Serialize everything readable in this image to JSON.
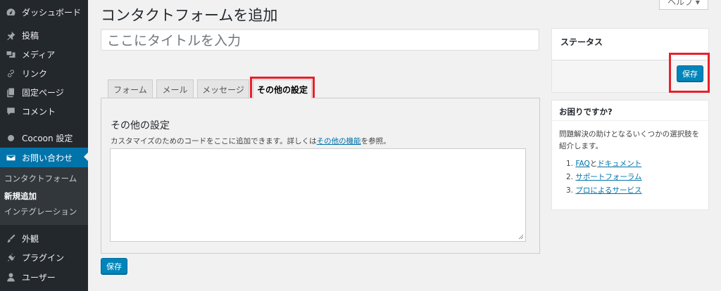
{
  "sidebar": {
    "items": [
      {
        "label": "ダッシュボード",
        "icon": "dashboard-icon"
      },
      {
        "label": "投稿",
        "icon": "pin-icon"
      },
      {
        "label": "メディア",
        "icon": "media-icon"
      },
      {
        "label": "リンク",
        "icon": "link-icon"
      },
      {
        "label": "固定ページ",
        "icon": "page-icon"
      },
      {
        "label": "コメント",
        "icon": "comment-icon"
      },
      {
        "label": "Cocoon 設定",
        "icon": "circle-icon"
      },
      {
        "label": "お問い合わせ",
        "icon": "mail-icon"
      },
      {
        "label": "外観",
        "icon": "appearance-icon"
      },
      {
        "label": "プラグイン",
        "icon": "plugin-icon"
      },
      {
        "label": "ユーザー",
        "icon": "user-icon"
      }
    ],
    "submenu": [
      "コンタクトフォーム",
      "新規追加",
      "インテグレーション"
    ]
  },
  "header": {
    "title": "コンタクトフォームを追加",
    "help_tab": "ヘルプ ▾"
  },
  "title_input": {
    "placeholder": "ここにタイトルを入力"
  },
  "tabs": [
    "フォーム",
    "メール",
    "メッセージ",
    "その他の設定"
  ],
  "panel": {
    "heading": "その他の設定",
    "desc_prefix": "カスタマイズのためのコードをここに追加できます。詳しくは",
    "desc_link": "その他の機能",
    "desc_suffix": "を参照。"
  },
  "save_label": "保存",
  "status_box": {
    "title": "ステータス"
  },
  "help_box": {
    "title": "お困りですか?",
    "desc": "問題解決の助けとなるいくつかの選択肢を紹介します。",
    "links": [
      {
        "num": "1.",
        "a": "FAQ",
        "mid": "と",
        "b": "ドキュメント"
      },
      {
        "num": "2.",
        "a": "サポートフォーラム"
      },
      {
        "num": "3.",
        "a": "プロによるサービス"
      }
    ]
  },
  "colors": {
    "sidebar_bg": "#23282d",
    "accent": "#0073aa",
    "button": "#0085ba",
    "highlight": "#e8202a"
  }
}
